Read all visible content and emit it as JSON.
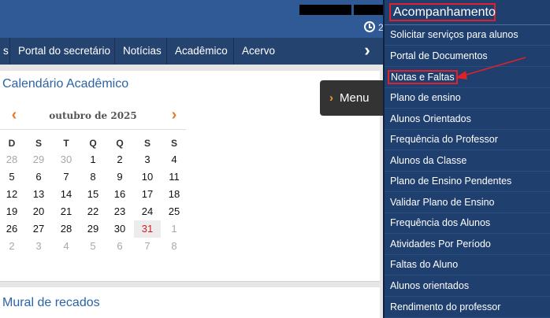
{
  "header": {
    "clock_digit": "2"
  },
  "nav": {
    "items": [
      {
        "label": "s"
      },
      {
        "label": "Portal do secretário"
      },
      {
        "label": "Notícias"
      },
      {
        "label": "Acadêmico"
      },
      {
        "label": "Acervo"
      }
    ],
    "more_glyph": "›"
  },
  "calendar": {
    "heading": "Calendário Acadêmico",
    "month": "outubro de 2025",
    "prev_glyph": "‹",
    "next_glyph": "›",
    "weekdays": [
      "D",
      "S",
      "T",
      "Q",
      "Q",
      "S",
      "S"
    ],
    "weeks": [
      [
        "28",
        "29",
        "30",
        "1",
        "2",
        "3",
        "4"
      ],
      [
        "5",
        "6",
        "7",
        "8",
        "9",
        "10",
        "11"
      ],
      [
        "12",
        "13",
        "14",
        "15",
        "16",
        "17",
        "18"
      ],
      [
        "19",
        "20",
        "21",
        "22",
        "23",
        "24",
        "25"
      ],
      [
        "26",
        "27",
        "28",
        "29",
        "30",
        "31",
        "1"
      ],
      [
        "2",
        "3",
        "4",
        "5",
        "6",
        "7",
        "8"
      ]
    ],
    "today": "31"
  },
  "menu_button": {
    "label": "Menu",
    "chevron": "›"
  },
  "mural": {
    "heading": "Mural de recados"
  },
  "dropdown": {
    "title": "Acompanhamento",
    "items": [
      {
        "label": "Solicitar serviços para alunos"
      },
      {
        "label": "Portal de Documentos"
      },
      {
        "label": "Notas e Faltas"
      },
      {
        "label": "Plano de ensino"
      },
      {
        "label": "Alunos Orientados"
      },
      {
        "label": "Frequência do Professor"
      },
      {
        "label": "Alunos da Classe"
      },
      {
        "label": "Plano de Ensino Pendentes"
      },
      {
        "label": "Validar Plano de Ensino"
      },
      {
        "label": "Frequência dos Alunos"
      },
      {
        "label": "Atividades Por Período"
      },
      {
        "label": "Faltas do Aluno"
      },
      {
        "label": "Alunos orientados"
      },
      {
        "label": "Rendimento do professor"
      }
    ]
  },
  "colors": {
    "header_blue": "#2f5a96",
    "nav_blue": "#25436f",
    "dropdown_blue": "#1f3f6e",
    "annotation_red": "#e0202a",
    "link_blue": "#2b63a8",
    "accent_orange": "#e87722"
  }
}
